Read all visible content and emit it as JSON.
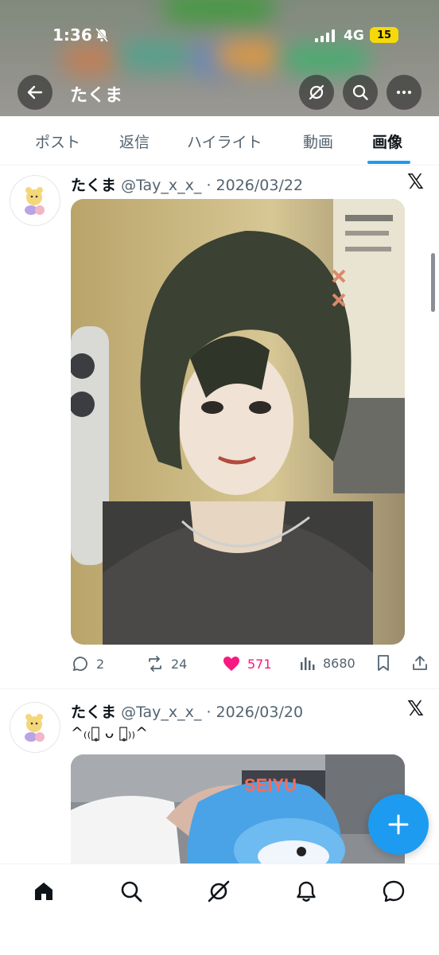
{
  "status_bar": {
    "time": "1:36",
    "network": "4G",
    "battery": "15"
  },
  "header": {
    "title": "たくま"
  },
  "tabs": [
    {
      "label": "ポスト",
      "active": false
    },
    {
      "label": "返信",
      "active": false
    },
    {
      "label": "ハイライト",
      "active": false
    },
    {
      "label": "動画",
      "active": false
    },
    {
      "label": "画像",
      "active": true
    }
  ],
  "posts": [
    {
      "name": "たくま",
      "handle": "@Tay_x_x_",
      "date": "2026/03/22",
      "replies": "2",
      "reposts": "24",
      "likes": "571",
      "views": "8680",
      "liked": true
    },
    {
      "name": "たくま",
      "handle": "@Tay_x_x_",
      "date": "2026/03/20",
      "text": "^₍₍ꈍ̥ ᴗ ꈍ̥₎₎^",
      "photo_sign": "SEIYU"
    }
  ],
  "colors": {
    "accent": "#1d9bf0",
    "like": "#f91880",
    "text": "#0f1419",
    "muted": "#536471"
  },
  "icons": {
    "header": [
      "back-arrow-icon",
      "grok-icon",
      "search-icon",
      "more-icon"
    ],
    "post_actions": [
      "reply-icon",
      "repost-icon",
      "heart-icon",
      "views-icon",
      "bookmark-icon",
      "share-icon"
    ],
    "bottom_nav": [
      "home-icon",
      "search-icon",
      "grok-icon",
      "notifications-icon",
      "messages-icon"
    ],
    "fab": "plus-icon"
  }
}
